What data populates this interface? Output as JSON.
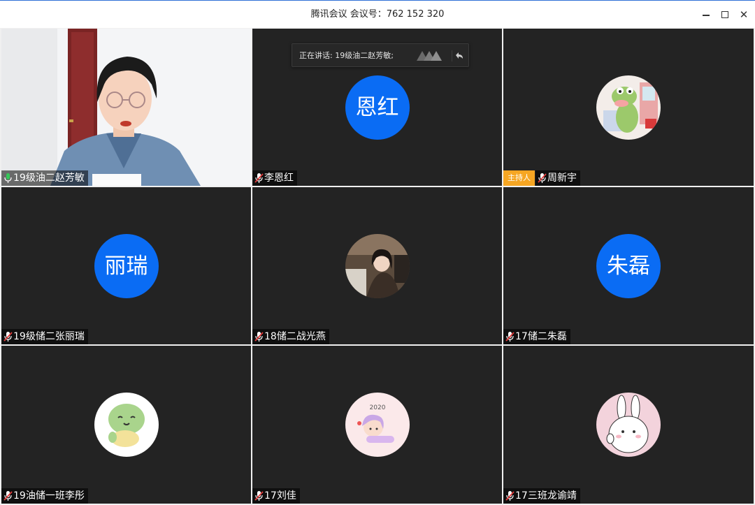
{
  "window": {
    "title": "腾讯会议 会议号：762 152 320",
    "minimize_icon": "minimize-icon",
    "maximize_icon": "maximize-icon",
    "close_icon": "close-icon",
    "close_glyph": "✕"
  },
  "speaking_banner": {
    "text": "正在讲话: 19级油二赵芳敏;"
  },
  "host_badge": "主持人",
  "participants": [
    {
      "name": "19级油二赵芳敏",
      "media": "camera-video",
      "mic": "active"
    },
    {
      "name": "李恩红",
      "avatar_text": "恩红",
      "mic": "muted"
    },
    {
      "name": "周新宇",
      "media": "cartoon-frog-avatar",
      "mic": "muted",
      "host": true
    },
    {
      "name": "19级储二张丽瑞",
      "avatar_text": "丽瑞",
      "mic": "muted"
    },
    {
      "name": "18储二战光燕",
      "media": "photo-avatar",
      "mic": "muted"
    },
    {
      "name": "17储二朱磊",
      "avatar_text": "朱磊",
      "mic": "muted"
    },
    {
      "name": "19油储一班李彤",
      "media": "cartoon-turtle-avatar",
      "mic": "muted"
    },
    {
      "name": "17刘佳",
      "media": "cartoon-girl-avatar",
      "avatar_caption": "2020",
      "mic": "muted"
    },
    {
      "name": "17三班龙谕靖",
      "media": "cartoon-rabbit-avatar",
      "mic": "muted"
    }
  ],
  "colors": {
    "text_avatar_bg": "#0a6cf4",
    "tile_bg": "#232323",
    "host_badge_bg": "#f6a623",
    "mic_active": "#35c759",
    "mic_muted": "#e23b3b"
  }
}
